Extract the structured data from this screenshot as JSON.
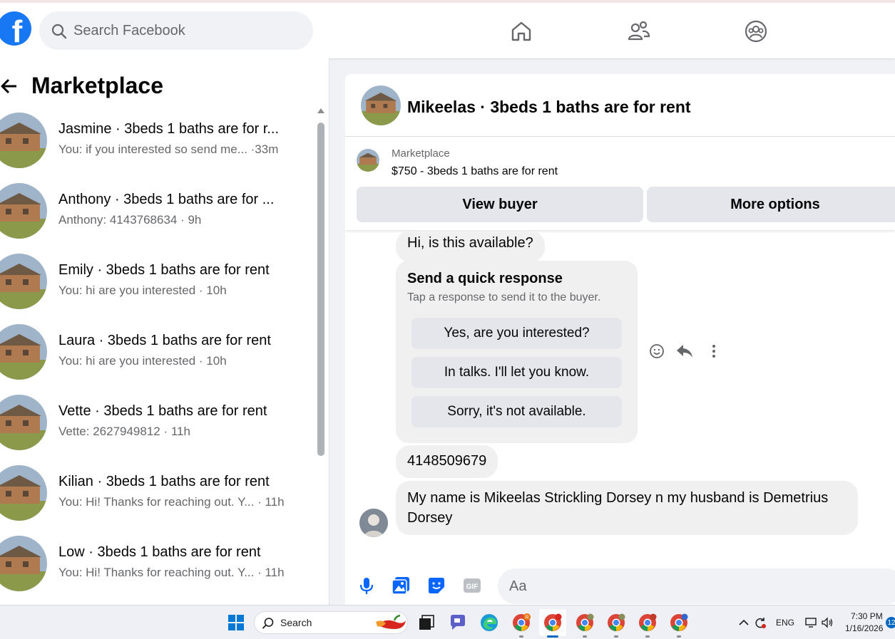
{
  "topbar": {
    "search_placeholder": "Search Facebook",
    "logo_letter": "f",
    "nav_icons": [
      "home-icon",
      "friends-icon",
      "groups-icon"
    ],
    "brand_color": "#1877f2"
  },
  "left_panel": {
    "title": "Marketplace",
    "conversations": [
      {
        "name": "Jasmine · 3beds 1 baths are for r...",
        "preview": "You: if you interested so send me... ·33m"
      },
      {
        "name": "Anthony · 3beds 1 baths are for ...",
        "preview": "Anthony: 4143768634 · 9h"
      },
      {
        "name": "Emily · 3beds 1 baths are for rent",
        "preview": "You: hi are you interested · 10h"
      },
      {
        "name": "Laura · 3beds 1 baths are for rent",
        "preview": "You: hi are you interested · 10h"
      },
      {
        "name": "Vette · 3beds 1 baths are for rent",
        "preview": "Vette: 2627949812 · 11h"
      },
      {
        "name": "Kilian · 3beds 1 baths are for rent",
        "preview": "You: Hi! Thanks for reaching out. Y... · 11h"
      },
      {
        "name": "Low · 3beds 1 baths are for rent",
        "preview": "You: Hi! Thanks for reaching out. Y... · 11h"
      }
    ]
  },
  "chat": {
    "title": "Mikeelas · 3beds 1 baths are for rent",
    "listing": {
      "label": "Marketplace",
      "price_title": "$750 - 3beds 1 baths are for rent"
    },
    "buttons": {
      "view_buyer": "View buyer",
      "more_options": "More options"
    },
    "messages": {
      "first": "Hi, is this available?",
      "quick_title": "Send a quick response",
      "quick_subtitle": "Tap a response to send it to the buyer.",
      "quick_replies": [
        "Yes, are you interested?",
        "In talks. I'll let you know.",
        "Sorry, it's not available."
      ],
      "phone": "4148509679",
      "name_msg": "My name is Mikeelas Strickling Dorsey n my husband is Demetrius Dorsey"
    },
    "message_actions": [
      "emoji-icon",
      "reply-icon",
      "more-icon"
    ],
    "composer": {
      "placeholder": "Aa",
      "icons": [
        "microphone-icon",
        "image-icon",
        "sticker-icon",
        "gif-icon"
      ],
      "gif_label": "GIF"
    }
  },
  "taskbar": {
    "search_label": "Search",
    "notification_badge": "R",
    "language": "ENG",
    "time": "7:30 PM",
    "date": "1/16/2026",
    "badge_count": "12",
    "apps": [
      "copilot-icon",
      "task-view-icon",
      "teams-icon",
      "edge-icon",
      "chrome-icon",
      "chrome-icon",
      "chrome-icon",
      "chrome-icon",
      "chrome-icon",
      "chrome-icon"
    ]
  }
}
